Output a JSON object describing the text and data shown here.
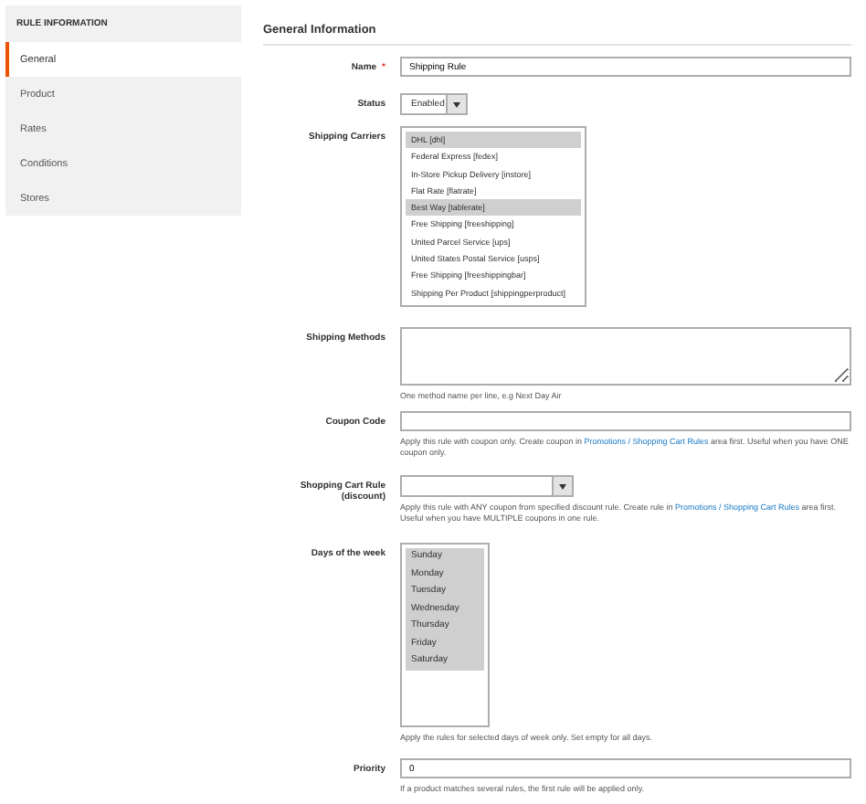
{
  "sidebar": {
    "title": "RULE INFORMATION",
    "items": [
      {
        "label": "General",
        "selected": true
      },
      {
        "label": "Product",
        "selected": false
      },
      {
        "label": "Rates",
        "selected": false
      },
      {
        "label": "Conditions",
        "selected": false
      },
      {
        "label": "Stores",
        "selected": false
      }
    ]
  },
  "section_title": "General Information",
  "fields": [
    {
      "kind": "text",
      "label": "Name",
      "required_mark": "*",
      "value": "Shipping Rule"
    },
    {
      "kind": "select",
      "label": "Status",
      "value": "Enabled"
    },
    {
      "kind": "multiselect",
      "label": "Shipping Carriers",
      "options": [
        {
          "label": "DHL [dhl]",
          "selected": true
        },
        {
          "label": "Federal Express [fedex]",
          "selected": false
        },
        {
          "label": "In-Store Pickup Delivery [instore]",
          "selected": false
        },
        {
          "label": "Flat Rate [flatrate]",
          "selected": false
        },
        {
          "label": "Best Way [tablerate]",
          "selected": true
        },
        {
          "label": "Free Shipping [freeshipping]",
          "selected": false
        },
        {
          "label": "United Parcel Service [ups]",
          "selected": false
        },
        {
          "label": "United States Postal Service [usps]",
          "selected": false
        },
        {
          "label": "Free Shipping [freeshippingbar]",
          "selected": false
        },
        {
          "label": "Shipping Per Product [shippingperproduct]",
          "selected": false
        }
      ]
    },
    {
      "kind": "textarea",
      "label": "Shipping Methods",
      "note": {
        "text": "One method name per line, e.g Next Day Air"
      }
    },
    {
      "kind": "text",
      "label": "Coupon Code",
      "note": {
        "text": "Apply this rule with coupon only. Create coupon in ",
        "link": "Promotions / Shopping Cart Rules",
        "after": " area first. Useful when you have ONE coupon only."
      }
    },
    {
      "kind": "select",
      "label": "Shopping Cart Rule (discount)",
      "note": {
        "text": "Apply this rule with ANY coupon from specified discount rule. Create rule in ",
        "link": "Promotions / Shopping Cart Rules",
        "after": " area first. Useful when you have MULTIPLE coupons in one rule."
      }
    },
    {
      "kind": "daylist",
      "label": "Days of the week",
      "options": [
        {
          "label": "Sunday",
          "selected": true
        },
        {
          "label": "Monday",
          "selected": true
        },
        {
          "label": "Tuesday",
          "selected": true
        },
        {
          "label": "Wednesday",
          "selected": true
        },
        {
          "label": "Thursday",
          "selected": true
        },
        {
          "label": "Friday",
          "selected": true
        },
        {
          "label": "Saturday",
          "selected": true
        }
      ],
      "note": {
        "text": "Apply the rules for selected days of week only. Set empty for all days."
      }
    },
    {
      "kind": "text",
      "label": "Priority",
      "value": "0",
      "note": {
        "text": "If a product matches several rules, the first rule will be applied only."
      }
    }
  ]
}
